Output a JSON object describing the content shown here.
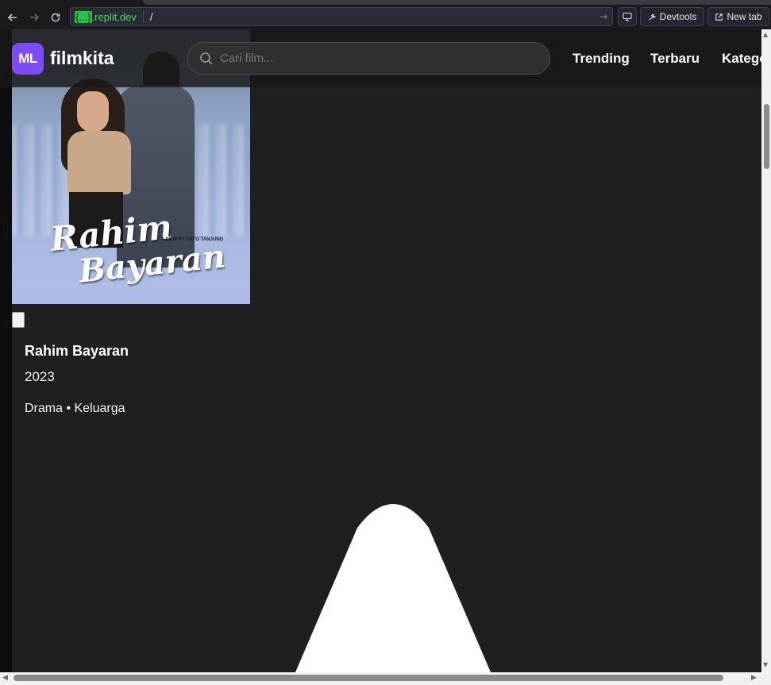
{
  "browser": {
    "url_prefix": "{...}",
    "url_domain": ".replit.dev",
    "url_path": "/",
    "devtools_label": "Devtools",
    "new_tab_label": "New tab"
  },
  "header": {
    "logo_badge": "ML",
    "logo_text": "filmkita",
    "search_placeholder": "Cari film...",
    "nav": [
      "Trending",
      "Terbaru",
      "Kategori"
    ]
  },
  "poster": {
    "title_line1": "Rahim",
    "title_line2": "Bayaran",
    "credit": "A FILM BY ANTO TANJUNG"
  },
  "movie": {
    "title": "Rahim Bayaran",
    "year": "2023",
    "genres": "Drama • Keluarga"
  },
  "colors": {
    "accent": "#7c4cf4",
    "page_bg": "#1f1f1f",
    "url_domain": "#52d36a"
  }
}
